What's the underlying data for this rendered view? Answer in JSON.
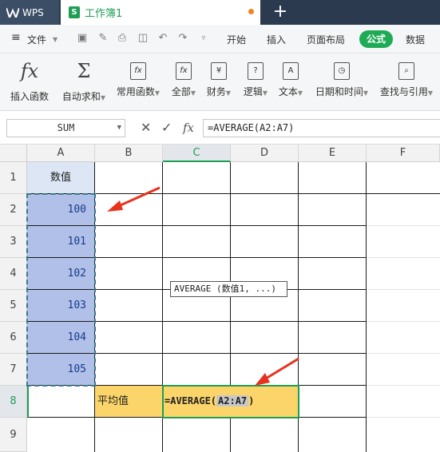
{
  "title_bar": {
    "app_name": "WPS",
    "document_tab": "工作簿1",
    "new_tab_symbol": "+"
  },
  "menu": {
    "file_label": "文件",
    "tabs": [
      "开始",
      "插入",
      "页面布局",
      "公式",
      "数据"
    ],
    "active_tab": "公式"
  },
  "ribbon": {
    "buttons": [
      {
        "label": "插入函数",
        "icon": "fx-icon"
      },
      {
        "label": "自动求和",
        "icon": "sigma-icon"
      },
      {
        "label": "常用函数",
        "icon": "common-functions-icon"
      },
      {
        "label": "全部",
        "icon": "all-functions-icon"
      },
      {
        "label": "财务",
        "icon": "finance-icon"
      },
      {
        "label": "逻辑",
        "icon": "logic-icon"
      },
      {
        "label": "文本",
        "icon": "text-icon"
      },
      {
        "label": "日期和时间",
        "icon": "datetime-icon"
      },
      {
        "label": "查找与引用",
        "icon": "lookup-icon"
      }
    ]
  },
  "formula_bar": {
    "name_box": "SUM",
    "fx_symbol": "fx",
    "formula": "=AVERAGE(A2:A7)"
  },
  "sheet": {
    "columns": [
      "A",
      "B",
      "C",
      "D",
      "E",
      "F"
    ],
    "active_column": "C",
    "rows": [
      "1",
      "2",
      "3",
      "4",
      "5",
      "6",
      "7",
      "8",
      "9"
    ],
    "active_row": "8",
    "a1_header": "数值",
    "a_values": [
      "100",
      "101",
      "102",
      "103",
      "104",
      "105"
    ],
    "b8_label": "平均值",
    "c8_formula_prefix": "=AVERAGE(",
    "c8_formula_ref": "A2:A7",
    "c8_formula_suffix": ")",
    "tooltip": "AVERAGE (数值1, ...)"
  },
  "colors": {
    "accent": "#1faa56",
    "selection": "#b0c0e8",
    "highlight": "#fbd56a",
    "arrow": "#e8321e"
  }
}
